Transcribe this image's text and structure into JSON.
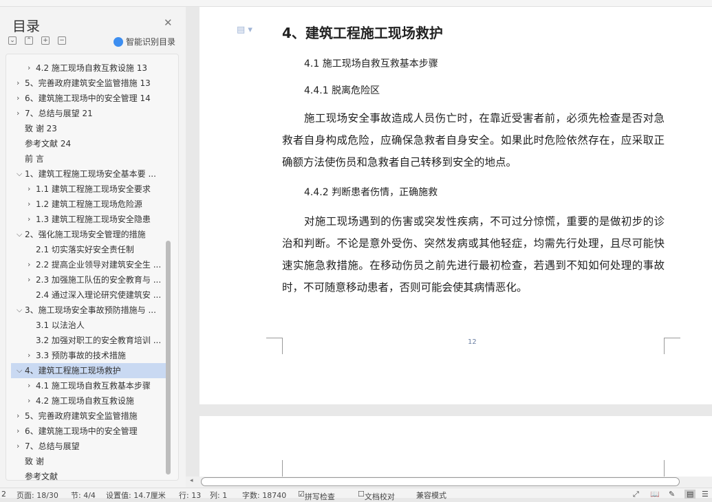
{
  "sidebar": {
    "title": "目录",
    "smart_label": "智能识别目录",
    "controls": [
      "expand-down",
      "collapse-up",
      "expand-all",
      "collapse-all"
    ],
    "items": [
      {
        "label": "4.2 施工现场自救互救设施  13",
        "level": 2,
        "chevron": "right"
      },
      {
        "label": "5、完善政府建筑安全监管措施  13",
        "level": 1,
        "chevron": "right"
      },
      {
        "label": "6、建筑施工现场中的安全管理  14",
        "level": 1,
        "chevron": "right"
      },
      {
        "label": "7、总结与展望  21",
        "level": 1,
        "chevron": "right"
      },
      {
        "label": "致  谢  23",
        "level": 1,
        "chevron": ""
      },
      {
        "label": "参考文献  24",
        "level": 1,
        "chevron": ""
      },
      {
        "label": "前  言",
        "level": 1,
        "chevron": ""
      },
      {
        "label": "1、建筑工程施工现场安全基本要 ...",
        "level": 1,
        "chevron": "down"
      },
      {
        "label": "1.1  建筑工程施工现场安全要求",
        "level": 2,
        "chevron": "right"
      },
      {
        "label": "1.2 建筑工程施工现场危险源",
        "level": 2,
        "chevron": "right"
      },
      {
        "label": "1.3 建筑工程施工现场安全隐患",
        "level": 2,
        "chevron": "right"
      },
      {
        "label": "2、强化施工现场安全管理的措施",
        "level": 1,
        "chevron": "down"
      },
      {
        "label": "2.1  切实落实好安全责任制",
        "level": 2,
        "chevron": ""
      },
      {
        "label": "2.2 提高企业领导对建筑安全生 ...",
        "level": 2,
        "chevron": "right"
      },
      {
        "label": " 2.3 加强施工队伍的安全教育与 ...",
        "level": 2,
        "chevron": "right"
      },
      {
        "label": "2.4 通过深入理论研究使建筑安 ...",
        "level": 2,
        "chevron": ""
      },
      {
        "label": "3、施工现场安全事故预防措施与 ...",
        "level": 1,
        "chevron": "down"
      },
      {
        "label": "3.1 以法治人",
        "level": 2,
        "chevron": ""
      },
      {
        "label": "3.2 加强对职工的安全教育培训 ...",
        "level": 2,
        "chevron": ""
      },
      {
        "label": "3.3 预防事故的技术措施",
        "level": 2,
        "chevron": "right"
      },
      {
        "label": "4、建筑工程施工现场救护",
        "level": 1,
        "chevron": "down",
        "selected": true
      },
      {
        "label": "4.1  施工现场自救互救基本步骤",
        "level": 2,
        "chevron": "right"
      },
      {
        "label": "4.2 施工现场自救互救设施",
        "level": 2,
        "chevron": "right"
      },
      {
        "label": "5、完善政府建筑安全监管措施",
        "level": 1,
        "chevron": "right"
      },
      {
        "label": "6、建筑施工现场中的安全管理",
        "level": 1,
        "chevron": "right"
      },
      {
        "label": "7、总结与展望",
        "level": 1,
        "chevron": "right"
      },
      {
        "label": "致  谢",
        "level": 1,
        "chevron": ""
      },
      {
        "label": "参考文献",
        "level": 1,
        "chevron": ""
      }
    ]
  },
  "document": {
    "heading": "4、建筑工程施工现场救护",
    "sub1": "4.1 施工现场自救互救基本步骤",
    "sub2": "4.4.1 脱离危险区",
    "para1": "施工现场安全事故造成人员伤亡时，在靠近受害者前，必须先检查是否对急救者自身构成危险，应确保急救者自身安全。如果此时危险依然存在，应采取正确额方法使伤员和急救者自己转移到安全的地点。",
    "sub3": "4.4.2 判断患者伤情，正确施救",
    "para2": "对施工现场遇到的伤害或突发性疾病，不可过分惊慌，重要的是做初步的诊治和判断。不论是意外受伤、突然发病或其他轻症，均需先行处理，且尽可能快速实施急救措施。在移动伤员之前先进行最初检查，若遇到不知如何处理的事故时，不可随意移动患者，否则可能会使其病情恶化。",
    "page_number": "12"
  },
  "status": {
    "s0": "2",
    "page": "页面: 18/30",
    "section": "节: 4/4",
    "setting": "设置值: 14.7厘米",
    "line": "行: 13",
    "col": "列: 1",
    "words": "字数: 18740",
    "spell": "拼写检查",
    "proof": "文档校对",
    "compat": "兼容模式"
  }
}
